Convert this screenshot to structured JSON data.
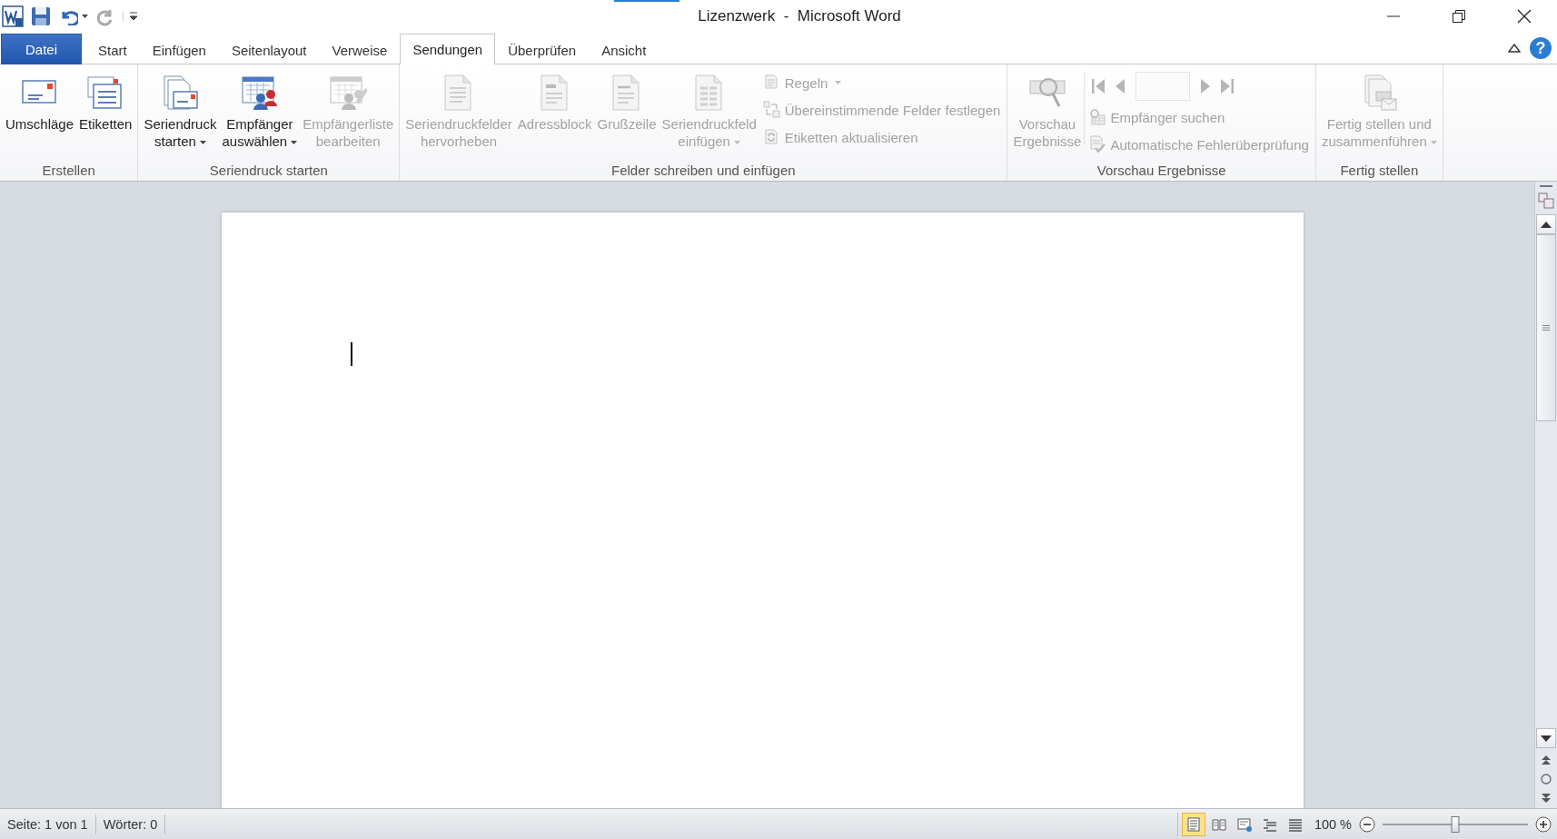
{
  "window": {
    "title": "Lizenzwerk  -  Microsoft Word",
    "help": "?"
  },
  "tabs": [
    {
      "label": "Datei",
      "kind": "file",
      "selected": false
    },
    {
      "label": "Start",
      "kind": "tab",
      "selected": false
    },
    {
      "label": "Einfügen",
      "kind": "tab",
      "selected": false
    },
    {
      "label": "Seitenlayout",
      "kind": "tab",
      "selected": false
    },
    {
      "label": "Verweise",
      "kind": "tab",
      "selected": false
    },
    {
      "label": "Sendungen",
      "kind": "tab",
      "selected": true
    },
    {
      "label": "Überprüfen",
      "kind": "tab",
      "selected": false
    },
    {
      "label": "Ansicht",
      "kind": "tab",
      "selected": false
    }
  ],
  "ribbon": {
    "groups": [
      {
        "label": "Erstellen",
        "items": [
          {
            "kind": "large",
            "lines": [
              "Umschläge"
            ],
            "disabled": false,
            "dropdown": false
          },
          {
            "kind": "large",
            "lines": [
              "Etiketten"
            ],
            "disabled": false,
            "dropdown": false
          }
        ]
      },
      {
        "label": "Seriendruck starten",
        "items": [
          {
            "kind": "large",
            "lines": [
              "Seriendruck",
              "starten"
            ],
            "disabled": false,
            "dropdown": true
          },
          {
            "kind": "large",
            "lines": [
              "Empfänger",
              "auswählen"
            ],
            "disabled": false,
            "dropdown": true
          },
          {
            "kind": "large",
            "lines": [
              "Empfängerliste",
              "bearbeiten"
            ],
            "disabled": true,
            "dropdown": false
          }
        ]
      },
      {
        "label": "Felder schreiben und einfügen",
        "items": [
          {
            "kind": "large",
            "lines": [
              "Seriendruckfelder",
              "hervorheben"
            ],
            "disabled": true,
            "dropdown": false
          },
          {
            "kind": "large",
            "lines": [
              "Adressblock"
            ],
            "disabled": true,
            "dropdown": false
          },
          {
            "kind": "large",
            "lines": [
              "Grußzeile"
            ],
            "disabled": true,
            "dropdown": false
          },
          {
            "kind": "large",
            "lines": [
              "Seriendruckfeld",
              "einfügen"
            ],
            "disabled": true,
            "dropdown": true
          },
          {
            "kind": "column",
            "items": [
              {
                "kind": "small",
                "label": "Regeln",
                "disabled": true,
                "dropdown": true
              },
              {
                "kind": "small",
                "label": "Übereinstimmende Felder festlegen",
                "disabled": true,
                "dropdown": false
              },
              {
                "kind": "small",
                "label": "Etiketten aktualisieren",
                "disabled": true,
                "dropdown": false
              }
            ]
          }
        ]
      },
      {
        "label": "Vorschau Ergebnisse",
        "items": [
          {
            "kind": "large",
            "lines": [
              "Vorschau",
              "Ergebnisse"
            ],
            "disabled": true,
            "dropdown": false
          },
          {
            "kind": "column",
            "items": [
              {
                "kind": "nav",
                "disabled": true
              },
              {
                "kind": "small",
                "label": "Empfänger suchen",
                "disabled": true,
                "dropdown": false
              },
              {
                "kind": "small",
                "label": "Automatische Fehlerüberprüfung",
                "disabled": true,
                "dropdown": false
              }
            ]
          }
        ]
      },
      {
        "label": "Fertig stellen",
        "items": [
          {
            "kind": "large",
            "lines": [
              "Fertig stellen und",
              "zusammenführen"
            ],
            "disabled": true,
            "dropdown": true
          }
        ]
      }
    ]
  },
  "status_bar": {
    "page": "Seite: 1 von 1",
    "words": "Wörter: 0",
    "views": [
      {
        "selected": true
      },
      {
        "selected": false
      },
      {
        "selected": false
      },
      {
        "selected": false
      },
      {
        "selected": false
      }
    ],
    "zoom": "100 %",
    "zoom_slider": {
      "level": 0.5
    }
  }
}
